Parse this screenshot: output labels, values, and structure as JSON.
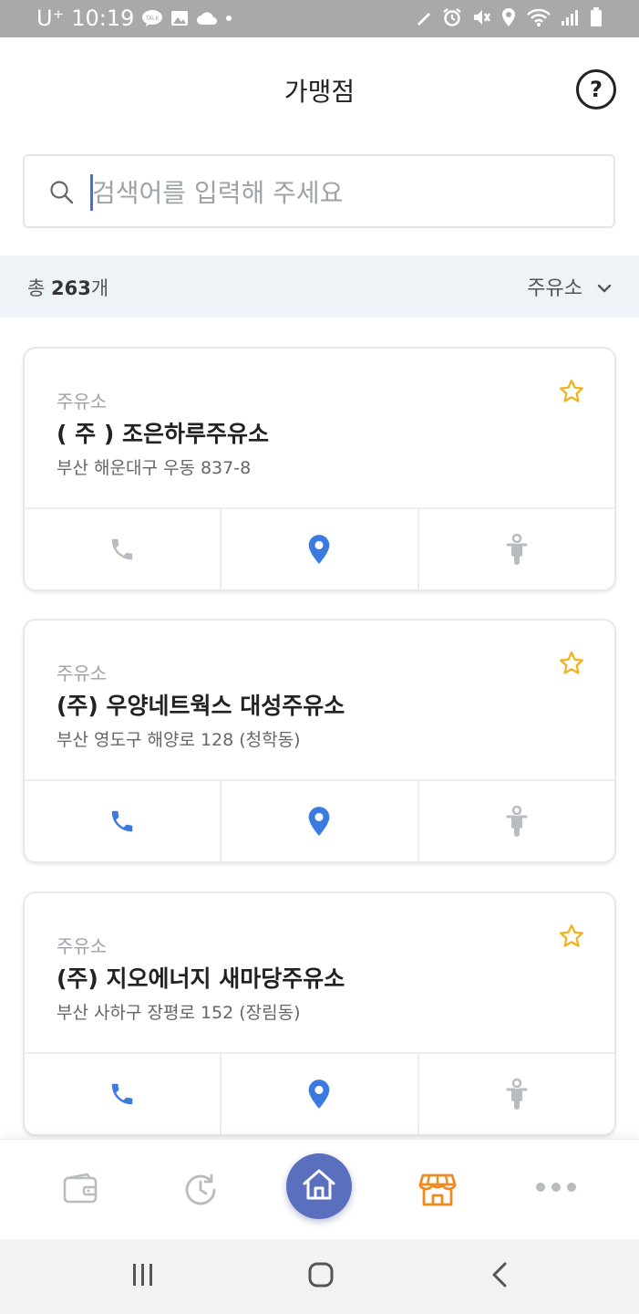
{
  "status_bar": {
    "carrier": "U⁺",
    "time": "10:19"
  },
  "header": {
    "title": "가맹점",
    "help_label": "?"
  },
  "search": {
    "placeholder": "검색어를 입력해 주세요",
    "value": ""
  },
  "filter": {
    "total_prefix": "총",
    "total_count": "263",
    "total_suffix": "개",
    "selected": "주유소"
  },
  "stations": [
    {
      "category": "주유소",
      "name": "( 주 ) 조은하루주유소",
      "address": "부산 해운대구 우동 837-8",
      "phone_active": false,
      "location_active": true,
      "delivery_active": false
    },
    {
      "category": "주유소",
      "name": "(주) 우양네트웍스 대성주유소",
      "address": "부산 영도구 해양로 128 (청학동)",
      "phone_active": true,
      "location_active": true,
      "delivery_active": false
    },
    {
      "category": "주유소",
      "name": "(주) 지오에너지 새마당주유소",
      "address": "부산 사하구 장평로 152 (장림동)",
      "phone_active": true,
      "location_active": true,
      "delivery_active": false
    }
  ],
  "bottom_nav": {
    "items": [
      "wallet-icon",
      "history-icon",
      "home-icon",
      "store-icon",
      "more-icon"
    ],
    "active": "store-icon"
  },
  "colors": {
    "accent_blue": "#3b7be0",
    "inactive_gray": "#b8bcc0",
    "star_yellow": "#f2b21b",
    "store_orange": "#f08a1f",
    "home_button": "#5b6fbf",
    "filter_bar_bg": "#edf3f7"
  }
}
